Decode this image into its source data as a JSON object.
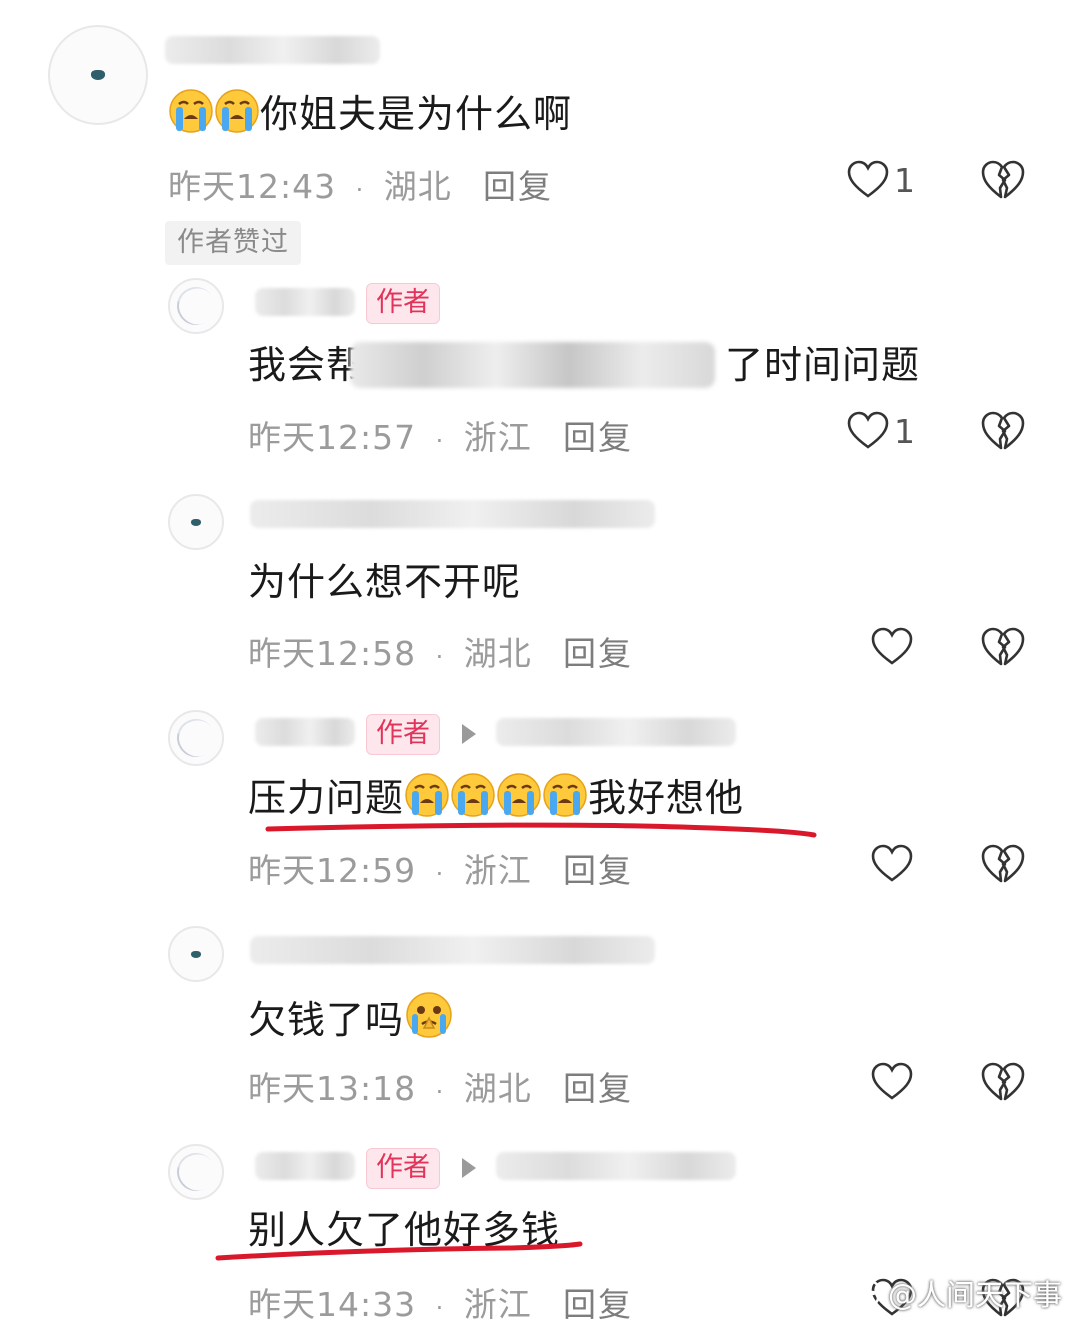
{
  "comments": [
    {
      "text": "你姐夫是为什么啊",
      "time": "昨天12:43",
      "region": "湖北",
      "reply": "回复",
      "likes": "1",
      "tag": "作者赞过"
    },
    {
      "badge": "作者",
      "text": "了时间问题",
      "time": "昨天12:57",
      "region": "浙江",
      "reply": "回复",
      "likes": "1"
    },
    {
      "text": "为什么想不开呢",
      "time": "昨天12:58",
      "region": "湖北",
      "reply": "回复"
    },
    {
      "badge": "作者",
      "text_before": "压力问题",
      "text_after": "我好想他",
      "time": "昨天12:59",
      "region": "浙江",
      "reply": "回复"
    },
    {
      "text": "欠钱了吗",
      "time": "昨天13:18",
      "region": "湖北",
      "reply": "回复"
    },
    {
      "badge": "作者",
      "text": "别人欠了他好多钱",
      "time": "昨天14:33",
      "region": "浙江",
      "reply": "回复"
    }
  ],
  "text_prefix": "我会帮",
  "separator": "·",
  "watermark": "@人间天下事",
  "colors": {
    "badge_text": "#e2335a",
    "badge_bg": "#fde7ec",
    "underline": "#d9182b"
  },
  "icons": [
    "heart-outline-icon",
    "broken-heart-icon",
    "loudly-crying-emoji",
    "hopeful-pleading-emoji"
  ]
}
